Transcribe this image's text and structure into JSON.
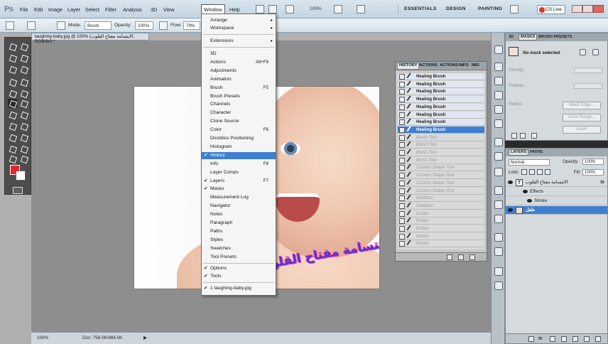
{
  "app": {
    "logo": "Ps"
  },
  "menubar": {
    "items": [
      "File",
      "Edit",
      "Image",
      "Layer",
      "Select",
      "Filter",
      "Analysis",
      "3D",
      "View",
      "Window",
      "Help"
    ],
    "zoom": "100%",
    "workspaces": [
      "ESSENTIALS",
      "DESIGN",
      "PAINTING"
    ],
    "cs_live": "CS Live"
  },
  "options": {
    "mode_label": "Mode:",
    "mode_value": "Brush",
    "opacity_label": "Opacity:",
    "opacity_value": "100%",
    "flow_label": "Flow:",
    "flow_value": "79%"
  },
  "document": {
    "tab_title": "laughing-baby.jpg @ 100% (الابتسامة مفتاح القلوب, RGB/8#) *",
    "overlay_text": "الابتسامة مفتاح القلوب"
  },
  "status": {
    "zoom": "100%",
    "doc": "Doc: 756.0K/984.0K"
  },
  "window_menu": {
    "top_items": [
      {
        "label": "Arrange",
        "arrow": "▸"
      },
      {
        "label": "Workspace",
        "arrow": "▸"
      },
      {
        "label": "Extensions",
        "arrow": "▸"
      }
    ],
    "panel_items": [
      {
        "label": "3D",
        "check": "",
        "shortcut": ""
      },
      {
        "label": "Actions",
        "check": "",
        "shortcut": "Alt+F9"
      },
      {
        "label": "Adjustments",
        "check": "",
        "shortcut": ""
      },
      {
        "label": "Animation",
        "check": "",
        "shortcut": ""
      },
      {
        "label": "Brush",
        "check": "",
        "shortcut": "F5"
      },
      {
        "label": "Brush Presets",
        "check": "",
        "shortcut": ""
      },
      {
        "label": "Channels",
        "check": "",
        "shortcut": ""
      },
      {
        "label": "Character",
        "check": "",
        "shortcut": ""
      },
      {
        "label": "Clone Source",
        "check": "",
        "shortcut": ""
      },
      {
        "label": "Color",
        "check": "",
        "shortcut": "F6"
      },
      {
        "label": "Dicolitics Positioning",
        "check": "",
        "shortcut": ""
      },
      {
        "label": "Histogram",
        "check": "",
        "shortcut": ""
      },
      {
        "label": "History",
        "check": "✔",
        "shortcut": ""
      },
      {
        "label": "Info",
        "check": "",
        "shortcut": "F8"
      },
      {
        "label": "Layer Comps",
        "check": "",
        "shortcut": ""
      },
      {
        "label": "Layers",
        "check": "✔",
        "shortcut": "F7"
      },
      {
        "label": "Masks",
        "check": "✔",
        "shortcut": ""
      },
      {
        "label": "Measurement Log",
        "check": "",
        "shortcut": ""
      },
      {
        "label": "Navigator",
        "check": "",
        "shortcut": ""
      },
      {
        "label": "Notes",
        "check": "",
        "shortcut": ""
      },
      {
        "label": "Paragraph",
        "check": "",
        "shortcut": ""
      },
      {
        "label": "Paths",
        "check": "",
        "shortcut": ""
      },
      {
        "label": "Styles",
        "check": "",
        "shortcut": ""
      },
      {
        "label": "Swatches",
        "check": "",
        "shortcut": ""
      },
      {
        "label": "Tool Presets",
        "check": "",
        "shortcut": ""
      }
    ],
    "bottom_items": [
      {
        "label": "Options",
        "check": "✔"
      },
      {
        "label": "Tools",
        "check": "✔"
      },
      {
        "label": "1 laughing-baby.jpg",
        "check": "✔"
      }
    ]
  },
  "history": {
    "tabs": [
      "HISTORY",
      "ACTIONS",
      "ACTIONS",
      "INFO",
      "IMG"
    ],
    "steps": [
      {
        "label": "Healing Brush",
        "state": "normal"
      },
      {
        "label": "Healing Brush",
        "state": "normal"
      },
      {
        "label": "Healing Brush",
        "state": "normal"
      },
      {
        "label": "Healing Brush",
        "state": "normal"
      },
      {
        "label": "Healing Brush",
        "state": "normal"
      },
      {
        "label": "Healing Brush",
        "state": "normal"
      },
      {
        "label": "Healing Brush",
        "state": "normal"
      },
      {
        "label": "Healing Brush",
        "state": "current"
      },
      {
        "label": "Brush Tool",
        "state": "ghost"
      },
      {
        "label": "Brush Tool",
        "state": "ghost"
      },
      {
        "label": "Brush Tool",
        "state": "ghost"
      },
      {
        "label": "Brush Tool",
        "state": "ghost"
      },
      {
        "label": "Custom Shape Tool",
        "state": "ghost"
      },
      {
        "label": "Custom Shape Tool",
        "state": "ghost"
      },
      {
        "label": "Custom Shape Tool",
        "state": "ghost"
      },
      {
        "label": "Custom Shape Tool",
        "state": "ghost"
      },
      {
        "label": "Gradient",
        "state": "ghost"
      },
      {
        "label": "Gradient",
        "state": "ghost"
      },
      {
        "label": "Eraser",
        "state": "ghost"
      },
      {
        "label": "Eraser",
        "state": "ghost"
      },
      {
        "label": "Eraser",
        "state": "ghost"
      },
      {
        "label": "Eraser",
        "state": "ghost"
      },
      {
        "label": "Eraser",
        "state": "ghost"
      }
    ]
  },
  "masks": {
    "tabs": [
      "3D",
      "MASKS",
      "BRUSH PRESETS"
    ],
    "title": "No mask selected",
    "density": "Density:",
    "feather": "Feather:",
    "refine": "Refine:",
    "btn_mask_edge": "Mask Edge...",
    "btn_color_range": "Color Range...",
    "btn_invert": "Invert"
  },
  "layers": {
    "tabs": [
      "LAYERS",
      "PATHS"
    ],
    "blend": "Normal",
    "opacity_label": "Opacity:",
    "opacity": "100%",
    "lock_label": "Lock:",
    "fill_label": "Fill:",
    "fill": "100%",
    "rows": [
      {
        "name": "الابتسامة مفتاح القلوب",
        "fx": "fx"
      },
      {
        "name": "Effects",
        "fx": ""
      },
      {
        "name": "Stroke",
        "fx": ""
      },
      {
        "name": "طفل",
        "fx": ""
      }
    ]
  },
  "colors": {
    "accent": "#3f7fd0",
    "foreground": "#e8222a",
    "background": "#ffffff",
    "text_fill": "#4b38d8",
    "text_stroke": "#ff44a0"
  }
}
